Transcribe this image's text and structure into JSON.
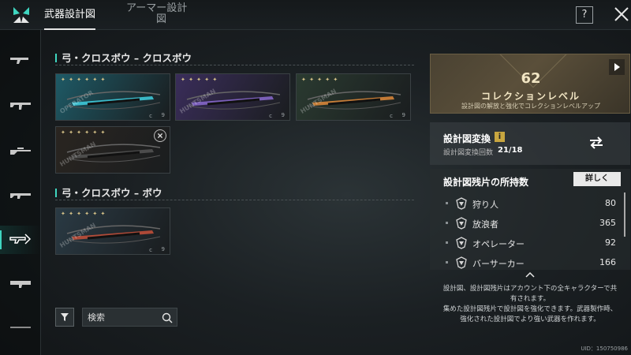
{
  "header": {
    "tab_weapon": "武器設計図",
    "tab_armor_line1": "アーマー設計",
    "tab_armor_line2": "図",
    "help_label": "?"
  },
  "sidebar": {
    "items": [
      {
        "icon": "smg-icon"
      },
      {
        "icon": "assault-rifle-icon"
      },
      {
        "icon": "sniper-rifle-icon"
      },
      {
        "icon": "shotgun-icon"
      },
      {
        "icon": "crossbow-icon",
        "active": true
      },
      {
        "icon": "launcher-icon"
      },
      {
        "icon": "melee-icon"
      }
    ]
  },
  "sections": [
    {
      "title": "弓・クロスボウ – クロスボウ",
      "cards": [
        {
          "stars": "✦ ✦ ✦ ✦ ✦ ✦",
          "brand": "OPERATOR",
          "level": "c",
          "mark": "9",
          "tint": "#1e5a66",
          "accent": "#3fd0e0"
        },
        {
          "stars": "✦ ✦ ✦ ✦ ✦",
          "brand": "HUNTSMAN",
          "level": "c",
          "mark": "9",
          "tint": "#3a2d5a",
          "accent": "#8a6ad0"
        },
        {
          "stars": "✦ ✦ ✦ ✦ ✦",
          "brand": "HUNTSMAN",
          "level": "c",
          "mark": "9",
          "tint": "#2a3a30",
          "accent": "#e08a3a"
        },
        {
          "stars": "✦ ✦ ✦ ✦ ✦ ✦",
          "brand": "HUNTSMAN",
          "level": "",
          "mark": "",
          "tint": "#2a2520",
          "accent": "#555555",
          "removable": true
        }
      ]
    },
    {
      "title": "弓・クロスボウ – ボウ",
      "cards": [
        {
          "stars": "✦ ✦ ✦ ✦ ✦ ✦",
          "brand": "HUNTSMAN",
          "level": "c",
          "mark": "9",
          "tint": "#2a3a44",
          "accent": "#c8503a"
        }
      ]
    }
  ],
  "toolbar": {
    "search_placeholder": "検索"
  },
  "collection": {
    "level": "62",
    "label": "コレクションレベル",
    "subtitle": "設計図の解放と強化でコレクションレベルアップ"
  },
  "conversion": {
    "title": "設計図変換",
    "info": "i",
    "count_label": "設計図変換回数",
    "count": "21/18"
  },
  "fragments": {
    "title": "設計図残片の所持数",
    "detail_button": "詳しく",
    "rows": [
      {
        "name": "狩り人",
        "count": "80"
      },
      {
        "name": "放浪者",
        "count": "365"
      },
      {
        "name": "オペレーター",
        "count": "92"
      },
      {
        "name": "バーサーカー",
        "count": "166"
      }
    ]
  },
  "note": {
    "line1": "設計図、設計図残片はアカウント下の全キャラクターで共",
    "line2": "有されます。",
    "line3": "集めた設計図残片で設計図を強化できます。武器製作時、",
    "line4": "強化された設計図でより強い武器を作れます。"
  },
  "uid": "UID：150750986",
  "colors": {
    "accent": "#3fd6c0",
    "gold": "#c8a640"
  }
}
